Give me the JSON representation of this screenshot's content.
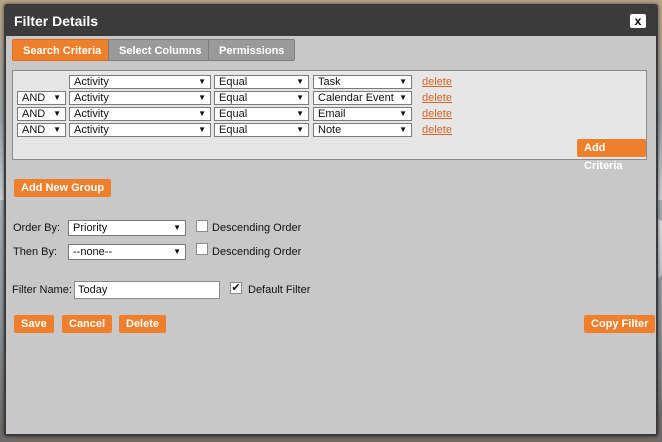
{
  "dialog": {
    "title": "Filter Details",
    "close_label": "x"
  },
  "tabs": [
    {
      "label": "Search Criteria"
    },
    {
      "label": "Select Columns"
    },
    {
      "label": "Permissions"
    }
  ],
  "criteria_rows": [
    {
      "connector": "",
      "field": "Activity",
      "operator": "Equal",
      "value": "Task",
      "delete": "delete"
    },
    {
      "connector": "AND",
      "field": "Activity",
      "operator": "Equal",
      "value": "Calendar Event",
      "delete": "delete"
    },
    {
      "connector": "AND",
      "field": "Activity",
      "operator": "Equal",
      "value": "Email",
      "delete": "delete"
    },
    {
      "connector": "AND",
      "field": "Activity",
      "operator": "Equal",
      "value": "Note",
      "delete": "delete"
    }
  ],
  "buttons": {
    "add_criteria": "Add Criteria",
    "add_new_group": "Add New Group",
    "save": "Save",
    "cancel": "Cancel",
    "delete": "Delete",
    "copy_filter": "Copy Filter"
  },
  "order": {
    "order_by_label": "Order By:",
    "order_by_value": "Priority",
    "order_desc_label": "Descending Order",
    "order_desc_checked": false,
    "then_by_label": "Then By:",
    "then_by_value": "--none--",
    "then_desc_label": "Descending Order",
    "then_desc_checked": false
  },
  "filter": {
    "name_label": "Filter Name:",
    "name_value": "Today",
    "default_label": "Default Filter",
    "default_checked": true
  },
  "colors": {
    "accent": "#ef7f2b",
    "tab_inactive": "#9a9a9a",
    "title_bar": "#3b3b3b",
    "link": "#d3632a"
  },
  "icons": {
    "close": "close-icon",
    "dropdown": "chevron-down-icon",
    "check": "checkmark-icon"
  }
}
